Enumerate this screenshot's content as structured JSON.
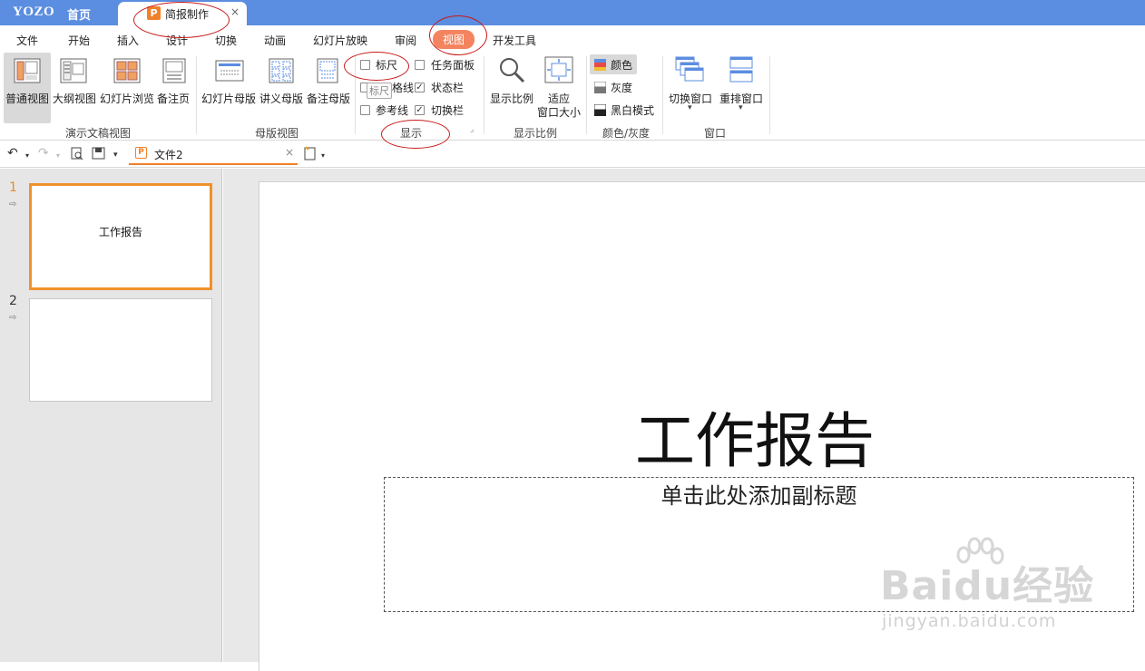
{
  "titlebar": {
    "logo": "YOZO",
    "home": "首页",
    "doc_tab": "简报制作",
    "doc_icon": "P",
    "close": "×"
  },
  "menu": {
    "items": [
      "文件",
      "开始",
      "插入",
      "设计",
      "切换",
      "动画",
      "幻灯片放映",
      "审阅",
      "视图",
      "开发工具"
    ],
    "active": "视图"
  },
  "ribbon": {
    "presentation_views": {
      "group_label": "演示文稿视图",
      "buttons": [
        "普通视图",
        "大纲视图",
        "幻灯片浏览",
        "备注页"
      ]
    },
    "master_views": {
      "group_label": "母版视图",
      "buttons": [
        "幻灯片母版",
        "讲义母版",
        "备注母版"
      ]
    },
    "show": {
      "group_label": "显示",
      "options": [
        {
          "label": "标尺",
          "checked": false
        },
        {
          "label": "网格线",
          "checked": false
        },
        {
          "label": "参考线",
          "checked": false
        },
        {
          "label": "任务面板",
          "checked": false
        },
        {
          "label": "状态栏",
          "checked": true
        },
        {
          "label": "切换栏",
          "checked": true
        }
      ],
      "tooltip": "标尺",
      "partial_label": "格线"
    },
    "zoom": {
      "group_label": "显示比例",
      "zoom_button": "显示比例",
      "fit_line1": "适应",
      "fit_line2": "窗口大小"
    },
    "color": {
      "group_label": "颜色/灰度",
      "options": [
        "颜色",
        "灰度",
        "黑白模式"
      ],
      "selected": "颜色"
    },
    "window": {
      "group_label": "窗口",
      "buttons": [
        "切换窗口",
        "重排窗口"
      ]
    }
  },
  "quickbar": {
    "file_tab": "文件2",
    "file_icon": "P",
    "close": "×"
  },
  "thumbnails": [
    {
      "number": "1",
      "title": "工作报告"
    },
    {
      "number": "2",
      "title": ""
    }
  ],
  "slide": {
    "title": "工作报告",
    "subtitle_placeholder": "单击此处添加副标题"
  },
  "watermark": {
    "brand": "Baidu经验",
    "url": "jingyan.baidu.com"
  },
  "colors": {
    "titlebar": "#5b8de0",
    "active_tab": "#f4845f",
    "accent": "#f0922a",
    "annotation": "#c71a1a"
  }
}
